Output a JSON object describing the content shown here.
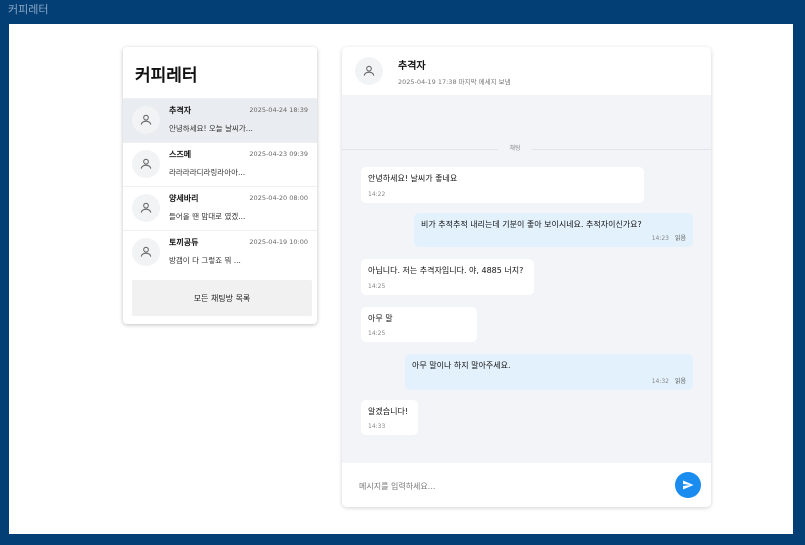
{
  "app": {
    "title": "커피레터"
  },
  "sidebar": {
    "title": "커피레터",
    "rooms": [
      {
        "name": "추격자",
        "date": "2025-04-24 18:39",
        "preview": "안녕하세요! 오늘 날씨가...",
        "active": true
      },
      {
        "name": "스즈메",
        "date": "2025-04-23 09:39",
        "preview": "라라라라디라링라아아...",
        "active": false
      },
      {
        "name": "양세바리",
        "date": "2025-04-20 08:00",
        "preview": "들어올 땐 맘대로 였겠...",
        "active": false
      },
      {
        "name": "토끼공듀",
        "date": "2025-04-19 10:00",
        "preview": "방갬이 다 그렇죠 뭐 ...",
        "active": false
      }
    ],
    "all_rooms_label": "모든 채팅방 목록"
  },
  "chat": {
    "title": "추격자",
    "subtitle": "2025-04-19 17:38 마지막 메세지 보냄",
    "divider_label": "채팅",
    "messages": [
      {
        "dir": "in",
        "text": "안녕하세요! 날씨가 좋네요",
        "time": "14:22"
      },
      {
        "dir": "out",
        "text": "비가 추적추적 내리는데 기분이 좋아 보이시네요. 추적자이신가요?",
        "time": "14:23",
        "read": "읽음"
      },
      {
        "dir": "in",
        "text": "아닙니다. 저는 추격자입니다. 야, 4885 너지?",
        "time": "14:25"
      },
      {
        "dir": "in",
        "text": "아무 말",
        "time": "14:25"
      },
      {
        "dir": "out",
        "text": "아무 말이나 하지 말아주세요.",
        "time": "14:32",
        "read": "읽음"
      },
      {
        "dir": "in",
        "text": "알겠습니다!",
        "time": "14:33"
      }
    ],
    "input_placeholder": "메시지를 입력하세요...",
    "send_icon": "send-icon"
  }
}
